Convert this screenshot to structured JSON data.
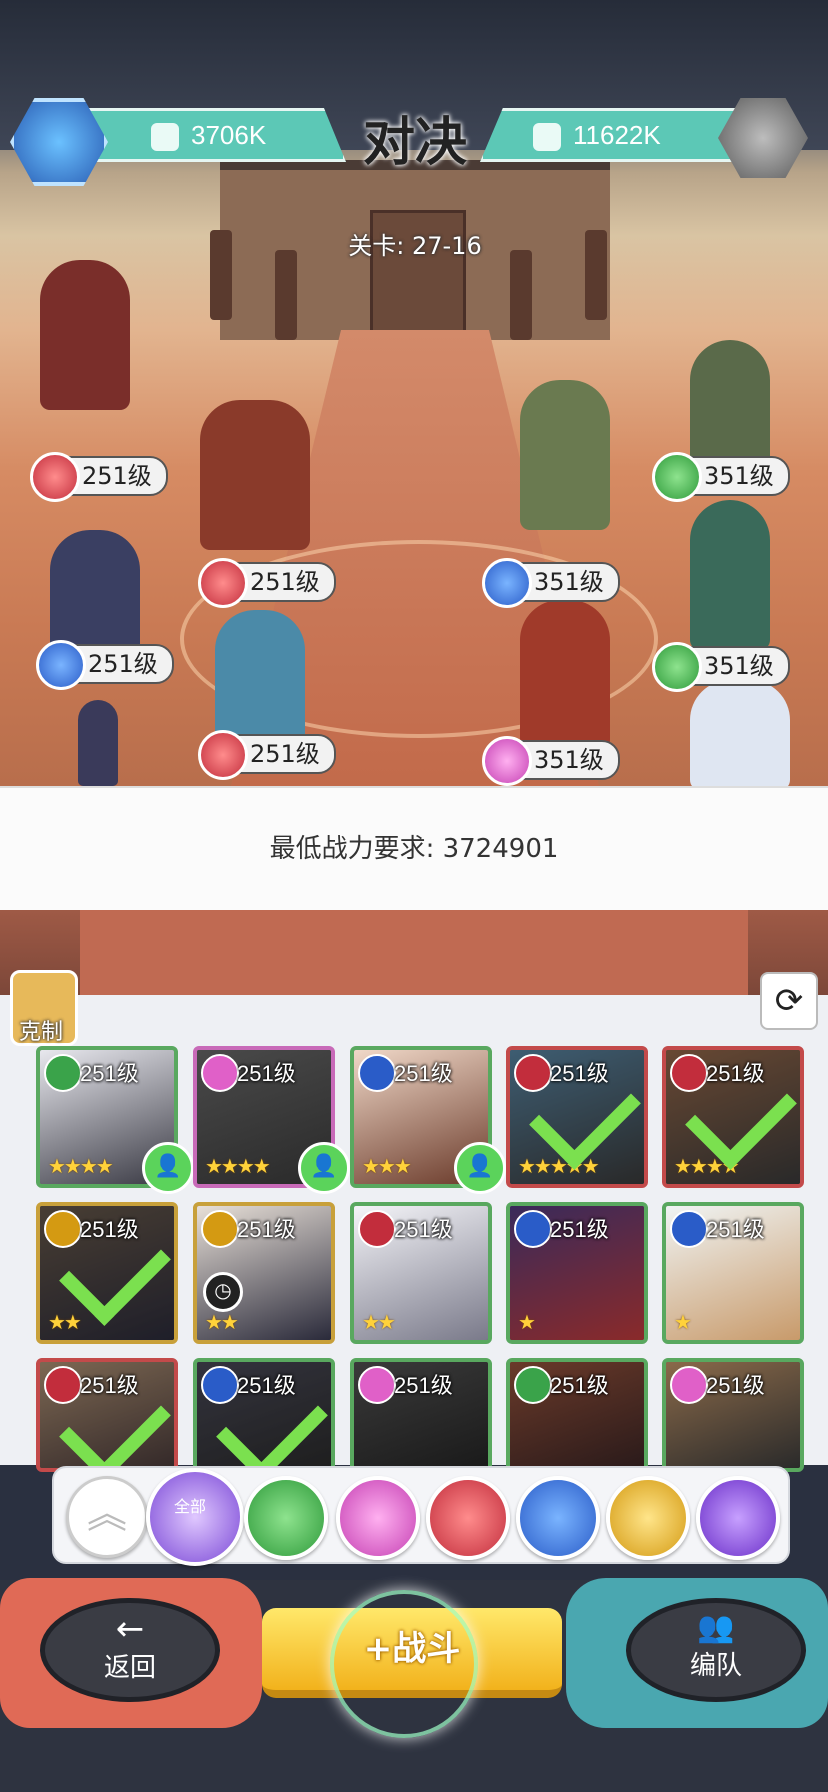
{
  "header": {
    "title": "对决",
    "left_power": "3706K",
    "right_power": "11622K",
    "stage": "关卡: 27-16"
  },
  "arena": {
    "left_team": [
      {
        "level": "251级",
        "element": "red"
      },
      {
        "level": "251级",
        "element": "red"
      },
      {
        "level": "251级",
        "element": "blue"
      },
      {
        "level": "251级",
        "element": "red"
      }
    ],
    "right_team": [
      {
        "level": "351级",
        "element": "green"
      },
      {
        "level": "351级",
        "element": "blue"
      },
      {
        "level": "351级",
        "element": "green"
      },
      {
        "level": "351级",
        "element": "pink"
      }
    ]
  },
  "requirement": {
    "text": "最低战力要求: 3724901"
  },
  "roster": {
    "counter_label": "克制",
    "cards": [
      {
        "level": "251级",
        "element": "green",
        "stars": "★★★★",
        "selected": false,
        "badge": "user"
      },
      {
        "level": "251级",
        "element": "pink",
        "stars": "★★★★",
        "selected": false,
        "badge": "user"
      },
      {
        "level": "251级",
        "element": "blue",
        "stars": "★★★",
        "selected": false,
        "badge": "user"
      },
      {
        "level": "251级",
        "element": "red",
        "stars": "★★★★★",
        "selected": true,
        "badge": ""
      },
      {
        "level": "251级",
        "element": "red",
        "stars": "★★★★",
        "selected": true,
        "badge": ""
      },
      {
        "level": "251级",
        "element": "gold",
        "stars": "★★",
        "selected": true,
        "badge": ""
      },
      {
        "level": "251级",
        "element": "gold",
        "stars": "★★",
        "selected": false,
        "badge": "clock"
      },
      {
        "level": "251级",
        "element": "red",
        "stars": "★★",
        "selected": false,
        "badge": ""
      },
      {
        "level": "251级",
        "element": "blue",
        "stars": "★",
        "selected": false,
        "badge": ""
      },
      {
        "level": "251级",
        "element": "blue",
        "stars": "★",
        "selected": false,
        "badge": ""
      },
      {
        "level": "251级",
        "element": "red",
        "stars": "",
        "selected": true,
        "badge": ""
      },
      {
        "level": "251级",
        "element": "blue",
        "stars": "",
        "selected": true,
        "badge": ""
      },
      {
        "level": "251级",
        "element": "pink",
        "stars": "",
        "selected": false,
        "badge": ""
      },
      {
        "level": "251级",
        "element": "green",
        "stars": "",
        "selected": false,
        "badge": ""
      },
      {
        "level": "251级",
        "element": "pink",
        "stars": "",
        "selected": false,
        "badge": ""
      }
    ]
  },
  "filters": {
    "all_label": "全部",
    "items": [
      "green",
      "pink",
      "red",
      "blue",
      "gold",
      "purple"
    ]
  },
  "controls": {
    "back_label": "返回",
    "battle_label": "+战斗",
    "team_label": "编队"
  }
}
